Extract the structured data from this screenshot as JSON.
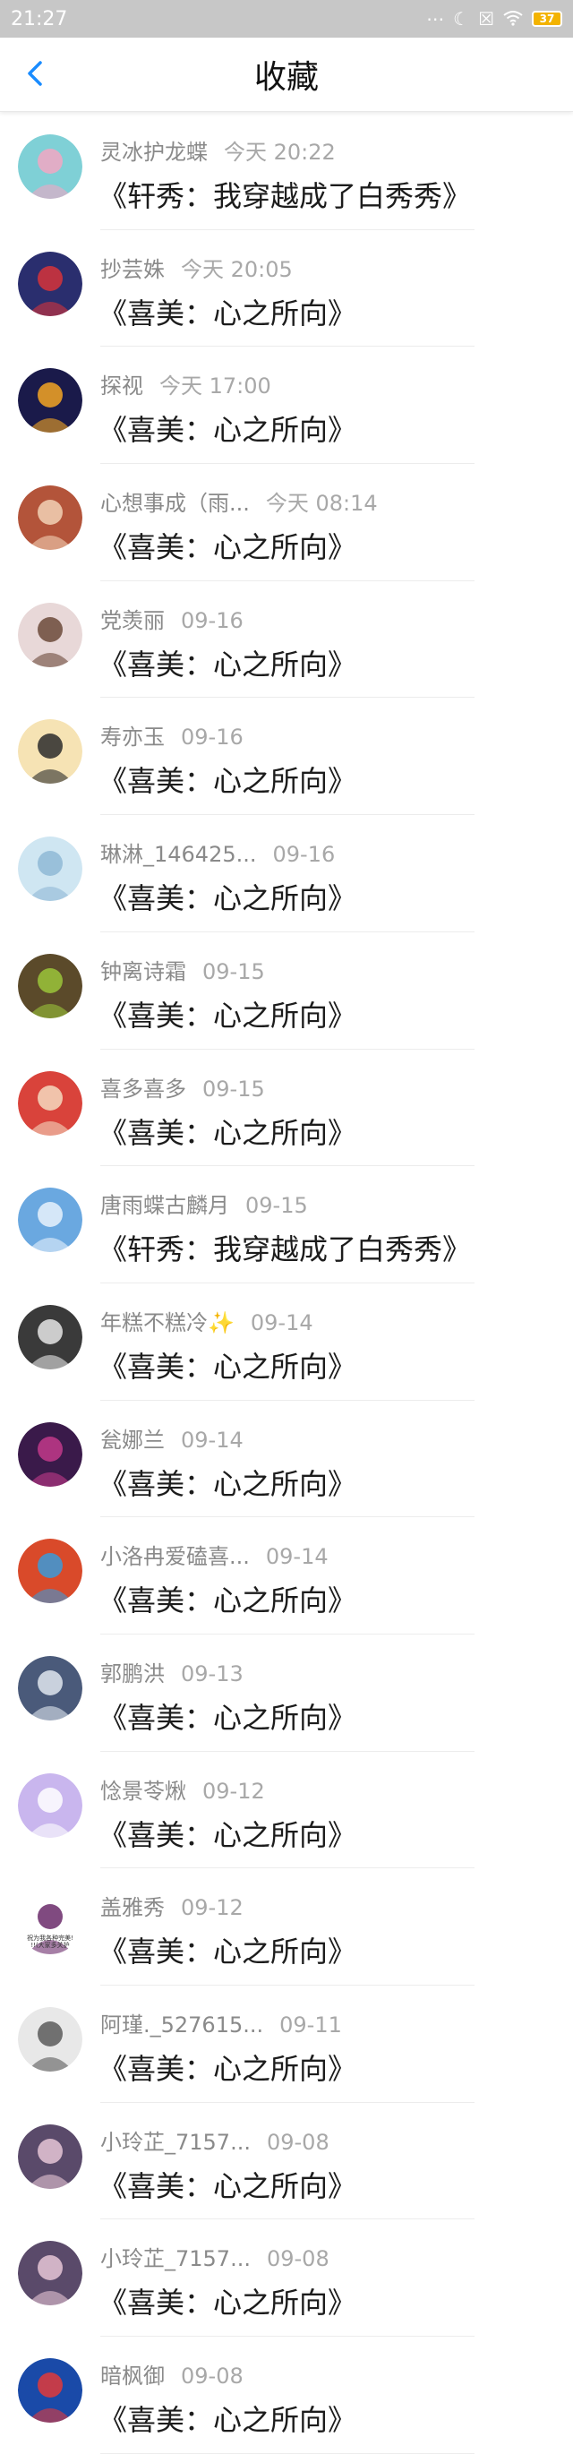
{
  "status_bar": {
    "time": "21:27",
    "battery": "37"
  },
  "header": {
    "title": "收藏"
  },
  "items": [
    {
      "name": "灵冰护龙蝶",
      "time": "今天 20:22",
      "book": "《轩秀：我穿越成了白秀秀》",
      "avatar_color": "#7fd0d6",
      "avatar_accent": "#f2a7c3"
    },
    {
      "name": "抄芸姝",
      "time": "今天 20:05",
      "book": "《喜美：心之所向》",
      "avatar_color": "#2a2e6e",
      "avatar_accent": "#d6333a"
    },
    {
      "name": "探视",
      "time": "今天 17:00",
      "book": "《喜美：心之所向》",
      "avatar_color": "#1a1a4a",
      "avatar_accent": "#f5a623"
    },
    {
      "name": "心想事成（雨...",
      "time": "今天 08:14",
      "book": "《喜美：心之所向》",
      "avatar_color": "#b3543a",
      "avatar_accent": "#f2d2b6"
    },
    {
      "name": "党羡丽",
      "time": "09-16",
      "book": "《喜美：心之所向》",
      "avatar_color": "#e8d8d8",
      "avatar_accent": "#6b4a3a"
    },
    {
      "name": "寿亦玉",
      "time": "09-16",
      "book": "《喜美：心之所向》",
      "avatar_color": "#f6e3b4",
      "avatar_accent": "#2b2b2b"
    },
    {
      "name": "琳淋_146425...",
      "time": "09-16",
      "book": "《喜美：心之所向》",
      "avatar_color": "#cfe6f2",
      "avatar_accent": "#8fb8d6"
    },
    {
      "name": "钟离诗霜",
      "time": "09-15",
      "book": "《喜美：心之所向》",
      "avatar_color": "#5b4a2a",
      "avatar_accent": "#9bc43a"
    },
    {
      "name": "喜多喜多",
      "time": "09-15",
      "book": "《喜美：心之所向》",
      "avatar_color": "#d9433b",
      "avatar_accent": "#f4d9c0"
    },
    {
      "name": "唐雨蝶古麟月",
      "time": "09-15",
      "book": "《轩秀：我穿越成了白秀秀》",
      "avatar_color": "#6aa8e0",
      "avatar_accent": "#e8f2fb"
    },
    {
      "name": "年糕不糕冷✨",
      "time": "09-14",
      "book": "《喜美：心之所向》",
      "avatar_color": "#3a3a3a",
      "avatar_accent": "#e6e6e6"
    },
    {
      "name": "瓮娜兰",
      "time": "09-14",
      "book": "《喜美：心之所向》",
      "avatar_color": "#3a1a4a",
      "avatar_accent": "#c23a8a"
    },
    {
      "name": "小洛冉爱磕喜...",
      "time": "09-14",
      "book": "《喜美：心之所向》",
      "avatar_color": "#d94a2a",
      "avatar_accent": "#3a9ad9"
    },
    {
      "name": "郭鹏洪",
      "time": "09-13",
      "book": "《喜美：心之所向》",
      "avatar_color": "#4a5a7a",
      "avatar_accent": "#dfe6ef"
    },
    {
      "name": "惗景苓煍",
      "time": "09-12",
      "book": "《喜美：心之所向》",
      "avatar_color": "#c9b6ee",
      "avatar_accent": "#ffffff"
    },
    {
      "name": "盖雅秀",
      "time": "09-12",
      "book": "《喜美：心之所向》",
      "avatar_color": "#ffffff",
      "avatar_accent": "#6a2a6a",
      "avatar_caption_1": "祝为我各种完美!",
      "avatar_caption_2": "!!(大家多关护"
    },
    {
      "name": "阿瑾._527615...",
      "time": "09-11",
      "book": "《喜美：心之所向》",
      "avatar_color": "#e8e8e8",
      "avatar_accent": "#5a5a5a"
    },
    {
      "name": "小玲芷_7157...",
      "time": "09-08",
      "book": "《喜美：心之所向》",
      "avatar_color": "#5a4a6a",
      "avatar_accent": "#e6c6d6"
    },
    {
      "name": "小玲芷_7157...",
      "time": "09-08",
      "book": "《喜美：心之所向》",
      "avatar_color": "#5a4a6a",
      "avatar_accent": "#e6c6d6"
    },
    {
      "name": "暗枫御",
      "time": "09-08",
      "book": "《喜美：心之所向》",
      "avatar_color": "#1a4aa8",
      "avatar_accent": "#e23a3a"
    }
  ]
}
